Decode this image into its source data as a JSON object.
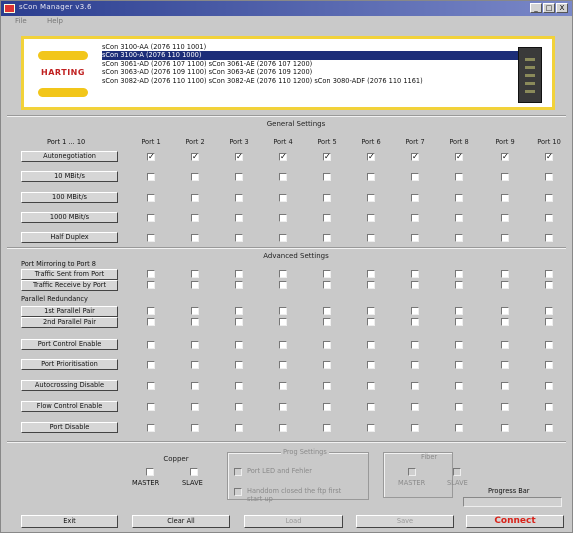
{
  "window": {
    "title": "sCon Manager v3.6",
    "controls": [
      "_",
      "□",
      "X"
    ]
  },
  "menu": [
    "File",
    "Help"
  ],
  "banner": {
    "logo_text": "HARTING",
    "devices": [
      "sCon 3100-AA (2076 110 1001)",
      "sCon 3100-A (2076 110 1000)",
      "sCon 3061-AD (2076 107 1100)  sCon 3061-AE (2076 107 1200)",
      "sCon 3063-AD (2076 109 1100)  sCon 3063-AE (2076 109 1200)",
      "sCon 3082-AD (2076 110 1100)  sCon 3082-AE (2076 110 1200)  sCon 3080-ADF (2076 110 1161)"
    ],
    "selected_index": 1
  },
  "general": {
    "title": "General Settings",
    "ports_label": "Port 1 ... 10",
    "ports": [
      "Port 1",
      "Port 2",
      "Port 3",
      "Port 4",
      "Port 5",
      "Port 6",
      "Port 7",
      "Port 8",
      "Port 9",
      "Port 10"
    ],
    "rows": [
      {
        "label": "Autonegotiation",
        "checked": [
          true,
          true,
          true,
          true,
          true,
          true,
          true,
          true,
          true,
          true
        ]
      },
      {
        "label": "10 MBit/s",
        "checked": [
          false,
          false,
          false,
          false,
          false,
          false,
          false,
          false,
          false,
          false
        ]
      },
      {
        "label": "100 MBit/s",
        "checked": [
          false,
          false,
          false,
          false,
          false,
          false,
          false,
          false,
          false,
          false
        ]
      },
      {
        "label": "1000 MBit/s",
        "checked": [
          false,
          false,
          false,
          false,
          false,
          false,
          false,
          false,
          false,
          false
        ]
      },
      {
        "label": "Half Duplex",
        "checked": [
          false,
          false,
          false,
          false,
          false,
          false,
          false,
          false,
          false,
          false
        ]
      }
    ]
  },
  "advanced": {
    "title": "Advanced Settings",
    "mirroring_label": "Port Mirroring to Port 8",
    "mirroring_rows": [
      "Traffic Sent from Port",
      "Traffic Receive by Port"
    ],
    "redundancy_label": "Parallel Redundancy",
    "redundancy_rows": [
      "1st Parallel Pair",
      "2nd Parallel Pair"
    ],
    "rows": [
      "Port Control Enable",
      "Port Prioritisation",
      "Autocrossing Disable",
      "Flow Control Enable",
      "Port Disable"
    ]
  },
  "copper": {
    "title": "Copper",
    "master": "MASTER",
    "slave": "SLAVE"
  },
  "prog": {
    "title": "Prog Settings",
    "opt1": "Port LED and Fehler",
    "opt2": "Handdom closed the ftp first start up"
  },
  "fiber": {
    "title": "Fiber",
    "master": "MASTER",
    "slave": "SLAVE"
  },
  "progress": {
    "label": "Progress Bar",
    "value": 0
  },
  "buttons": {
    "exit": "Exit",
    "clear": "Clear All",
    "load": "Load",
    "save": "Save",
    "connect": "Connect"
  }
}
